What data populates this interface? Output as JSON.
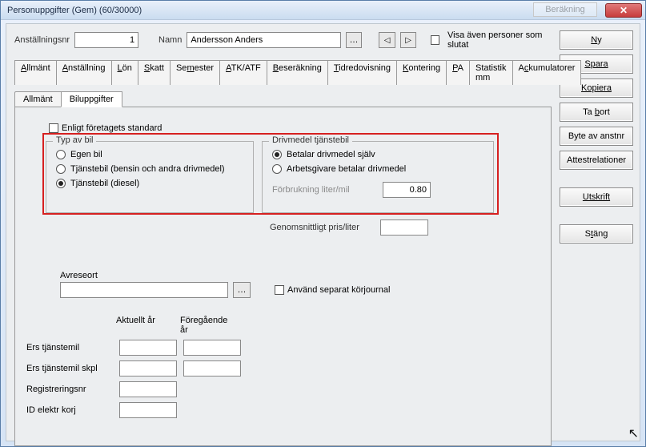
{
  "window": {
    "title": "Personuppgifter (Gem) (60/30000)",
    "ghost_button": "Beräkning"
  },
  "top": {
    "anst_label": "Anställningsnr",
    "anst_value": "1",
    "namn_label": "Namn",
    "namn_value": "Andersson Anders",
    "show_ended_label": "Visa även personer som slutat",
    "show_ended_checked": false
  },
  "main_tabs": [
    "Allmänt",
    "Anställning",
    "Lön",
    "Skatt",
    "Semester",
    "ATK/ATF",
    "Beseräkning",
    "Tidredovisning",
    "Kontering",
    "PA",
    "Statistik mm",
    "Ackumulatorer"
  ],
  "main_tabs_underline_idx": [
    0,
    0,
    0,
    0,
    2,
    0,
    0,
    0,
    0,
    0,
    12,
    1
  ],
  "sub_tabs": [
    "Allmänt",
    "Biluppgifter"
  ],
  "sub_tab_active": 1,
  "std": {
    "label": "Enligt företagets standard",
    "checked": false
  },
  "group_left": {
    "legend": "Typ av bil",
    "options": [
      "Egen bil",
      "Tjänstebil (bensin och andra drivmedel)",
      "Tjänstebil (diesel)"
    ],
    "selected": 2
  },
  "group_right": {
    "legend": "Drivmedel tjänstebil",
    "options": [
      "Betalar drivmedel själv",
      "Arbetsgivare betalar drivmedel"
    ],
    "selected": 0,
    "forbrukning_label": "Förbrukning liter/mil",
    "forbrukning_value": "0.80"
  },
  "below": {
    "pris_label": "Genomsnittligt pris/liter",
    "pris_value": ""
  },
  "depart": {
    "label": "Avreseort",
    "value": "",
    "sep_label": "Använd separat körjournal",
    "sep_checked": false
  },
  "years": {
    "col1": "Aktuellt år",
    "col2": "Föregående år",
    "rows": [
      {
        "label": "Ers tjänstemil",
        "cur": "",
        "prev": ""
      },
      {
        "label": "Ers tjänstemil skpl",
        "cur": "",
        "prev": ""
      },
      {
        "label": "Registreringsnr",
        "cur": ""
      },
      {
        "label": "ID elektr korj",
        "cur": ""
      }
    ]
  },
  "side": {
    "ny": "Ny",
    "spara": "Spara",
    "kopiera": "Kopiera",
    "tabort": "Ta bort",
    "byte": "Byte av anstnr",
    "attest": "Attestrelationer",
    "utskrift": "Utskrift",
    "stang": "Stäng"
  }
}
